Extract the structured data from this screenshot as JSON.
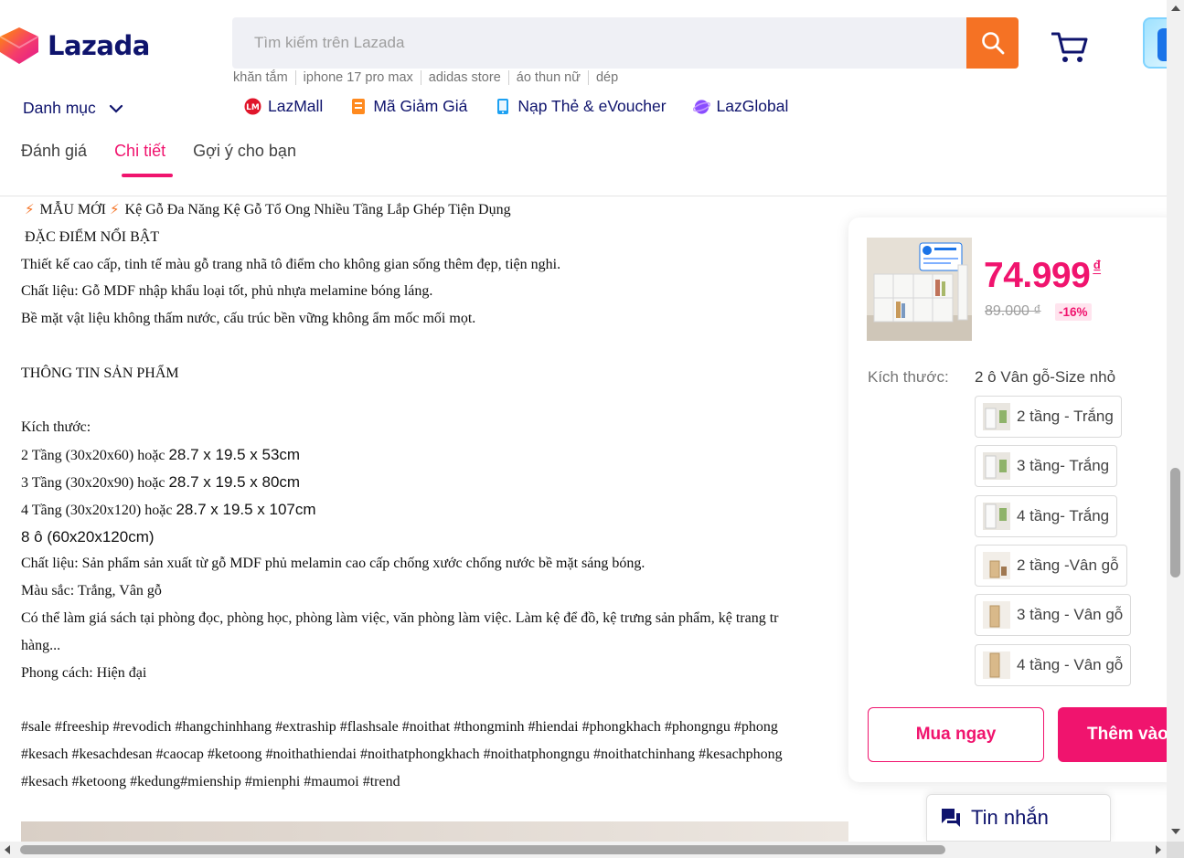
{
  "header": {
    "logo_text": "Lazada",
    "search_placeholder": "Tìm kiếm trên Lazada",
    "keywords": [
      "khăn tắm",
      "iphone 17 pro max",
      "adidas store",
      "áo thun nữ",
      "dép"
    ],
    "category_label": "Danh mục",
    "services": [
      "LazMall",
      "Mã Giảm Giá",
      "Nạp Thẻ & eVoucher",
      "LazGlobal"
    ]
  },
  "tabs": [
    "Đánh giá",
    "Chi tiết",
    "Gợi ý cho bạn"
  ],
  "description": {
    "title_a": "MẪU MỚI",
    "title_b": "Kệ Gỗ Đa Năng Kệ Gỗ Tổ Ong Nhiều Tầng Lắp Ghép Tiện Dụng",
    "heading": "ĐẶC ĐIỂM NỔI BẬT",
    "feature_1": "Thiết kế cao cấp, tinh tế màu gỗ trang nhã tô điểm cho không gian sống thêm đẹp, tiện nghi.",
    "feature_2": "Chất liệu: Gỗ MDF nhập khẩu loại tốt, phủ nhựa melamine bóng láng.",
    "feature_3": "Bề mặt vật liệu không thấm nước, cấu trúc bền vững không ẩm mốc mối mọt.",
    "info_heading": "THÔNG TIN SẢN PHẨM",
    "size_heading": "Kích thước:",
    "size_1a": "2 Tầng (30x20x60) hoặc",
    "size_1b": "28.7 x 19.5 x 53cm",
    "size_2a": "3 Tầng (30x20x90) hoặc",
    "size_2b": "28.7 x 19.5 x 80cm",
    "size_3a": "4 Tầng (30x20x120) hoặc",
    "size_3b": "28.7 x 19.5 x 107cm",
    "size_4": "8 ô (60x20x120cm)",
    "material": "Chất liệu: Sản phẩm sản xuất từ gỗ MDF phủ melamin cao cấp chống xước chống nước bề mặt sáng bóng.",
    "colors": "Màu sắc: Trắng, Vân gỗ",
    "usage_1": "Có thể làm giá sách tại phòng đọc, phòng học, phòng làm việc, văn phòng làm việc. Làm kệ để đồ, kệ trưng sản phẩm, kệ trang tr",
    "usage_2": "hàng...",
    "style": "Phong cách: Hiện đại",
    "tags_1": "#sale #freeship #revodich #hangchinhhang #extraship #flashsale #noithat #thongminh #hiendai #phongkhach #phongngu #phong",
    "tags_2": "#kesach #kesachdesan #caocap #ketoong #noithathiendai #noithatphongkhach #noithatphongngu #noithatchinhang #kesachphong",
    "tags_3": "#kesach #ketoong #kedung#mienship #mienphi #maumoi #trend"
  },
  "panel": {
    "price": "74.999",
    "currency": "₫",
    "old_price": "89.000 ₫",
    "discount": "-16%",
    "size_label": "Kích thước:",
    "size_value": "2 ô Vân gỗ-Size nhỏ",
    "options": [
      "2 tầng - Trắng",
      "3 tầng- Trắng",
      "4 tầng- Trắng",
      "2 tầng -Vân gỗ",
      "3 tầng - Vân gỗ",
      "4 tầng - Vân gỗ"
    ],
    "buy_now": "Mua ngay",
    "add_to_cart": "Thêm vào giỏ hàng"
  },
  "chat_label": "Tin nhắn",
  "colors": {
    "brand_pink": "#f0146e",
    "brand_orange": "#f57224",
    "navy": "#0f146d"
  }
}
